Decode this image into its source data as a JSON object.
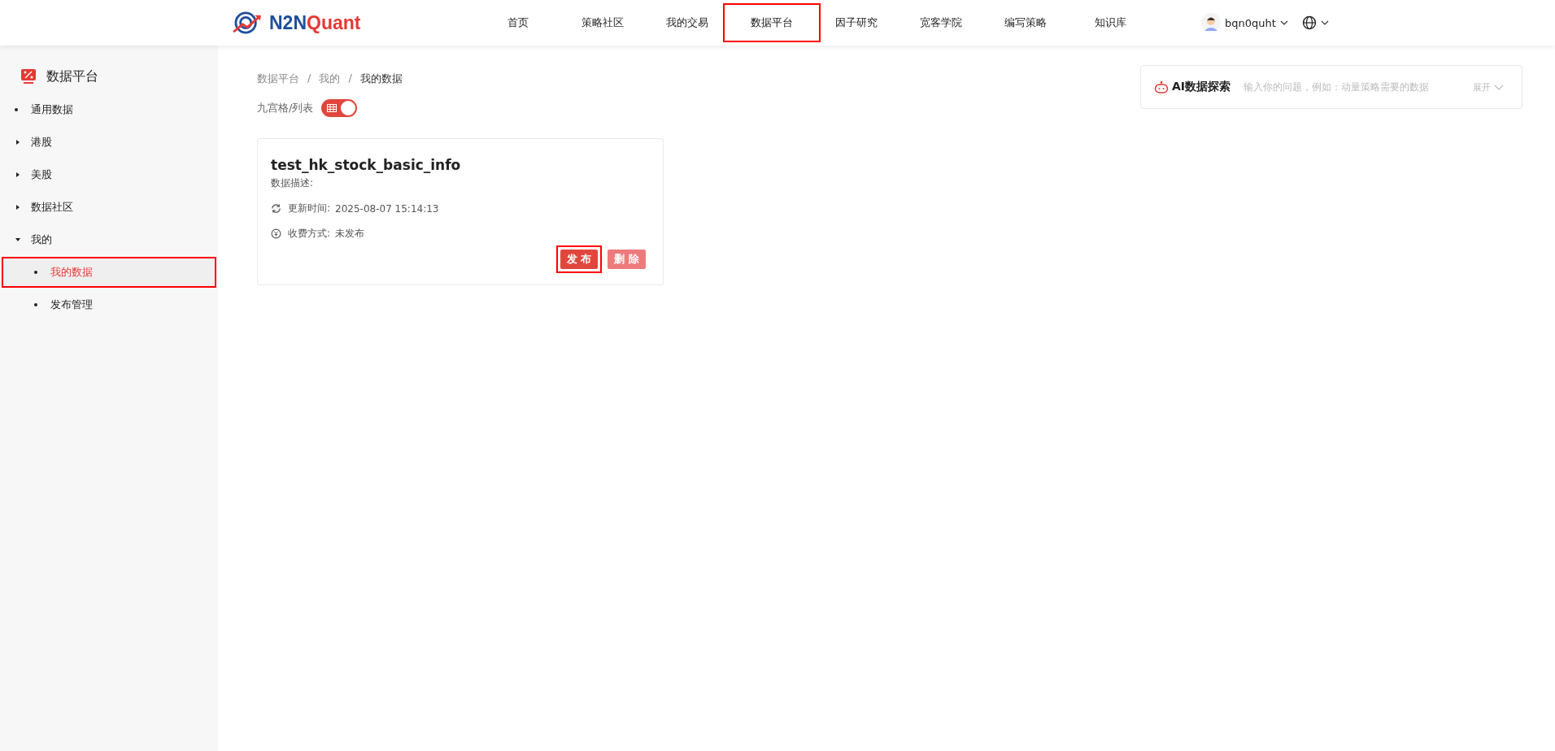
{
  "header": {
    "logo": {
      "prefix": "N2N",
      "suffix": "Quant"
    },
    "nav": [
      {
        "label": "首页",
        "selected": false,
        "highlighted": false
      },
      {
        "label": "策略社区",
        "selected": false,
        "highlighted": false
      },
      {
        "label": "我的交易",
        "selected": false,
        "highlighted": false
      },
      {
        "label": "数据平台",
        "selected": true,
        "highlighted": true
      },
      {
        "label": "因子研究",
        "selected": false,
        "highlighted": false
      },
      {
        "label": "宽客学院",
        "selected": false,
        "highlighted": false
      },
      {
        "label": "编写策略",
        "selected": false,
        "highlighted": false
      },
      {
        "label": "知识库",
        "selected": false,
        "highlighted": false
      }
    ],
    "user": {
      "name": "bqn0quht"
    }
  },
  "sidebar": {
    "title": "数据平台",
    "items": [
      {
        "label": "通用数据",
        "kind": "leaf",
        "selected": false,
        "highlighted": false
      },
      {
        "label": "港股",
        "kind": "group",
        "expanded": false,
        "selected": false,
        "highlighted": false
      },
      {
        "label": "美股",
        "kind": "group",
        "expanded": false,
        "selected": false,
        "highlighted": false
      },
      {
        "label": "数据社区",
        "kind": "group",
        "expanded": false,
        "selected": false,
        "highlighted": false
      },
      {
        "label": "我的",
        "kind": "group",
        "expanded": true,
        "selected": false,
        "highlighted": false,
        "children": [
          {
            "label": "我的数据",
            "selected": true,
            "highlighted": true
          },
          {
            "label": "发布管理",
            "selected": false,
            "highlighted": false
          }
        ]
      }
    ]
  },
  "breadcrumb": [
    {
      "kind": "link",
      "text": "数据平台"
    },
    {
      "kind": "separator",
      "text": "/"
    },
    {
      "kind": "link",
      "text": "我的"
    },
    {
      "kind": "separator",
      "text": "/"
    },
    {
      "kind": "current",
      "text": "我的数据"
    }
  ],
  "view_toggle": {
    "label": "九宫格/列表",
    "on": true
  },
  "cards": [
    {
      "title": "test_hk_stock_basic_info",
      "description_label": "数据描述:",
      "updated_label": "更新时间:",
      "updated_value": "2025-08-07 15:14:13",
      "fee_label": "收费方式:",
      "fee_value": "未发布",
      "buttons": [
        {
          "label": "发 布",
          "kind": "primary",
          "highlighted": true
        },
        {
          "label": "删 除",
          "kind": "danger",
          "highlighted": false
        }
      ]
    }
  ],
  "ai_search": {
    "title": "AI数据探索",
    "placeholder": "输入你的问题，例如：动量策略需要的数据",
    "expand_label": "展开"
  }
}
